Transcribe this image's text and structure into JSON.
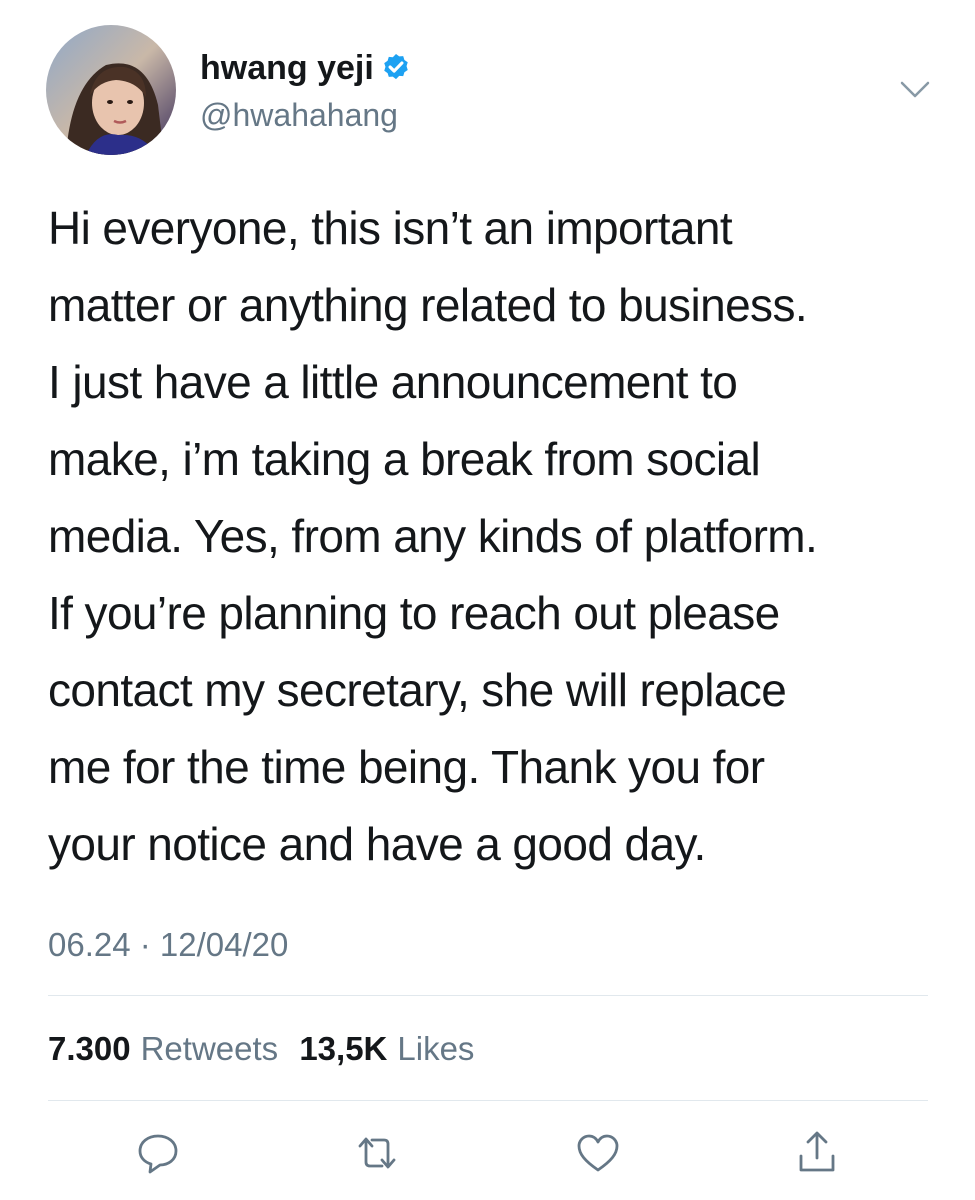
{
  "author": {
    "display_name": "hwang yeji",
    "handle": "@hwahahang",
    "verified": true,
    "avatar_icon": "profile-photo"
  },
  "tweet": {
    "lines": [
      "Hi everyone, this isn’t an important",
      "matter or anything related to business.",
      "I just have a little announcement to",
      "make, i’m taking a break from social",
      "media. Yes, from any kinds of platform.",
      "If you’re planning to reach out please",
      "contact my secretary, she will replace",
      "me for the time being. Thank you for",
      "your notice and have a good day."
    ],
    "timestamp": "06.24 · 12/04/20"
  },
  "stats": {
    "retweets_count": "7.300",
    "retweets_label": "Retweets",
    "likes_count": "13,5K",
    "likes_label": "Likes"
  },
  "actions": {
    "icons": [
      "reply-icon",
      "retweet-icon",
      "like-icon",
      "share-icon"
    ]
  },
  "colors": {
    "text": "#14171a",
    "secondary": "#657786",
    "verified": "#1da1f2",
    "divider": "#e1e8ed"
  }
}
